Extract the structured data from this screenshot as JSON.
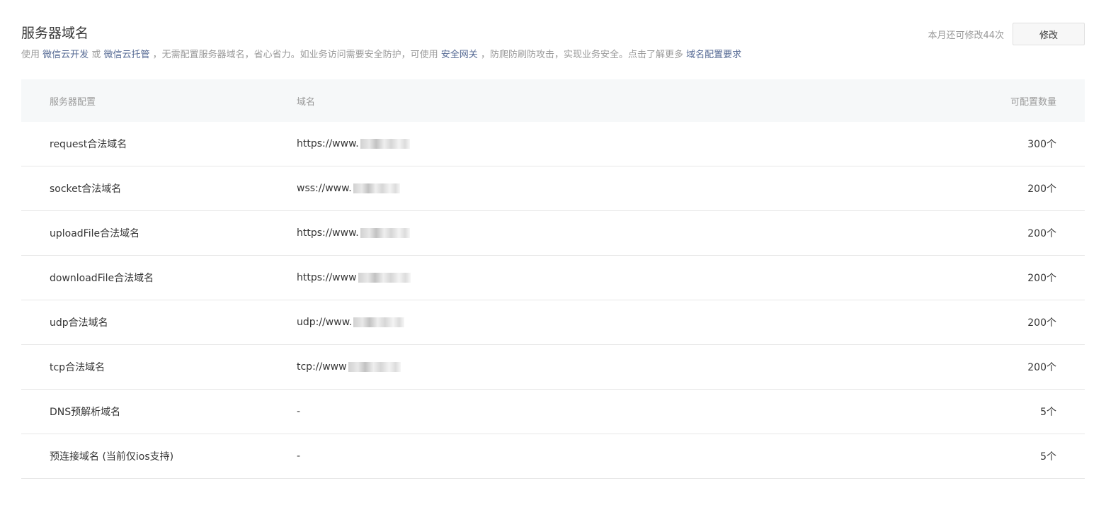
{
  "header": {
    "title": "服务器域名",
    "remaining": "本月还可修改44次",
    "modify_label": "修改",
    "desc": {
      "t1": "使用",
      "link1": "微信云开发",
      "t2": "或",
      "link2": "微信云托管",
      "t3": "，无需配置服务器域名，省心省力。如业务访问需要安全防护，可使用",
      "link3": "安全网关",
      "t4": "，防爬防刷防攻击，实现业务安全。点击了解更多",
      "link4": "域名配置要求"
    }
  },
  "table": {
    "columns": [
      "服务器配置",
      "域名",
      "可配置数量"
    ],
    "rows": [
      {
        "config": "request合法域名",
        "domain": "https://www.",
        "redacted": true,
        "count": "300个"
      },
      {
        "config": "socket合法域名",
        "domain": "wss://www.",
        "redacted": true,
        "count": "200个"
      },
      {
        "config": "uploadFile合法域名",
        "domain": "https://www.",
        "redacted": true,
        "count": "200个"
      },
      {
        "config": "downloadFile合法域名",
        "domain": "https://www",
        "redacted": true,
        "count": "200个"
      },
      {
        "config": "udp合法域名",
        "domain": "udp://www.",
        "redacted": true,
        "count": "200个"
      },
      {
        "config": "tcp合法域名",
        "domain": "tcp://www",
        "redacted": true,
        "count": "200个"
      },
      {
        "config": "DNS预解析域名",
        "domain": "-",
        "redacted": false,
        "count": "5个"
      },
      {
        "config": "预连接域名 (当前仅ios支持)",
        "domain": "-",
        "redacted": false,
        "count": "5个"
      }
    ]
  }
}
